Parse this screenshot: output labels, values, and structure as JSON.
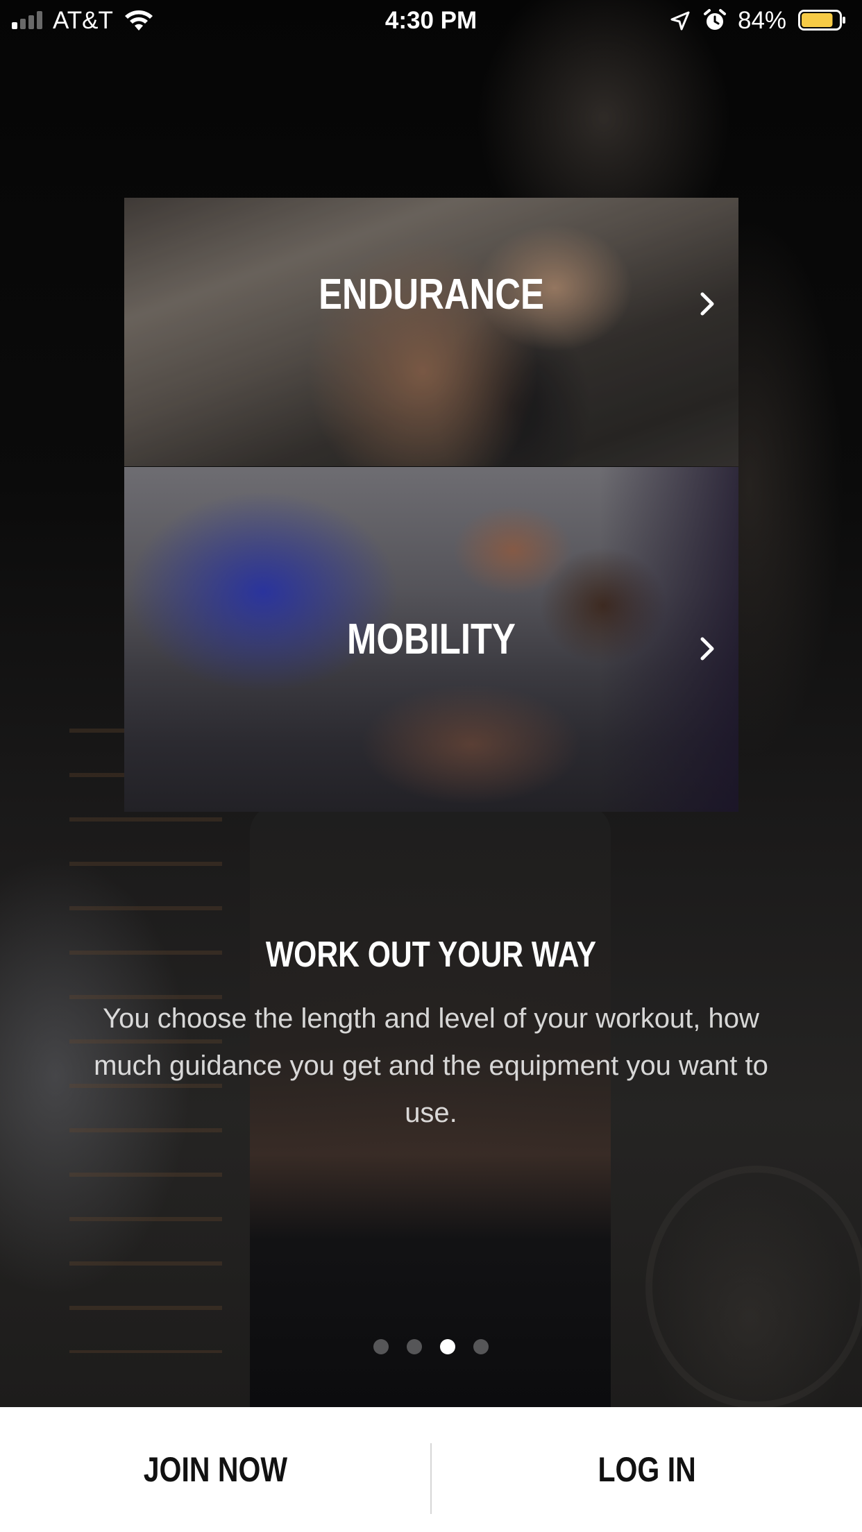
{
  "status_bar": {
    "carrier": "AT&T",
    "time": "4:30 PM",
    "battery_percent": "84%",
    "signal_bars_active": 1,
    "signal_bars_total": 4,
    "battery_level": 0.84,
    "battery_color": "#F7CB46",
    "icons": [
      "signal-icon",
      "wifi-icon",
      "location-icon",
      "alarm-icon",
      "battery-icon"
    ]
  },
  "cards": [
    {
      "title": "ENDURANCE",
      "icon": "chevron-right-icon"
    },
    {
      "title": "MOBILITY",
      "icon": "chevron-right-icon"
    }
  ],
  "onboarding": {
    "headline": "WORK OUT YOUR WAY",
    "body": "You choose the length and level of your workout, how much guidance you get and the equipment you want to use.",
    "page_count": 4,
    "current_page": 3
  },
  "bottom_bar": {
    "join_label": "JOIN NOW",
    "login_label": "LOG IN"
  }
}
